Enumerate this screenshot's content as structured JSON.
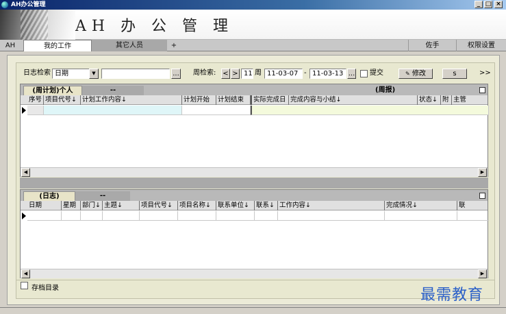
{
  "window": {
    "title": "AH办公管理",
    "controls": {
      "minimize": "_",
      "maximize": "□",
      "close": "×"
    }
  },
  "banner": {
    "brand": "AH 办 公 管 理"
  },
  "tabs": {
    "ah": "AH",
    "items": [
      "我的工作",
      "其它人员",
      "+"
    ],
    "right": [
      "佐手",
      "权限设置"
    ]
  },
  "toolbar": {
    "log_search_label": "日志检索",
    "search_type": "日期",
    "search_text": "",
    "browse": "...",
    "week_search_label": "周检索:",
    "prev": "<",
    "next": ">",
    "week_number": "11",
    "week_unit": "周",
    "date_from": "11-03-07",
    "date_sep": "-",
    "date_to": "11-03-13",
    "date_browse": "...",
    "submit_label": "提交",
    "edit_label": "修改",
    "extra_label": "s",
    "more": ">>"
  },
  "weekly_panel": {
    "tab_personal": "(周计划)个人",
    "tab_other": "--",
    "report_label": "(周报)",
    "columns": [
      "序号",
      "项目代号↓",
      "计划工作内容↓",
      "计划开始",
      "计划结束",
      "实际完成日",
      "完成内容与小结↓",
      "状态↓",
      "附",
      "主管"
    ]
  },
  "log_panel": {
    "tab_log": "(日志)",
    "tab_other": "--",
    "columns": [
      "日期",
      "星期",
      "部门↓",
      "主题↓",
      "项目代号↓",
      "项目名称↓",
      "联系单位↓",
      "联系↓",
      "工作内容↓",
      "完成情况↓",
      "联"
    ]
  },
  "archive_label": "存档目录",
  "watermark": "最需教育",
  "colors": {
    "accent_tab": "#e8e4c8",
    "watermark": "#2a5fc8"
  }
}
